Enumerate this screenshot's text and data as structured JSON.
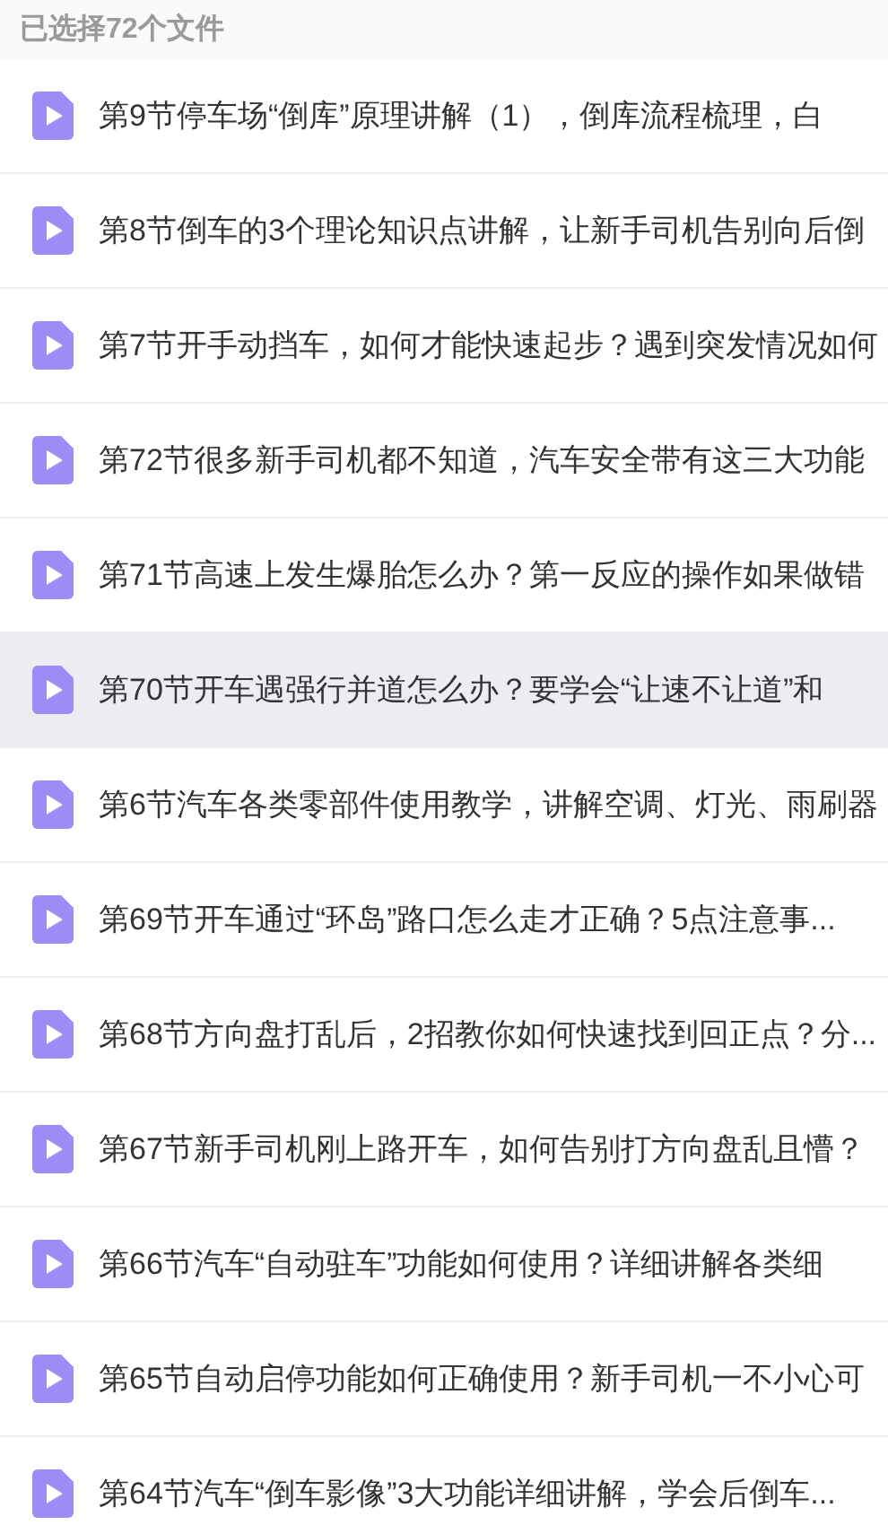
{
  "header": {
    "title": "已选择72个文件"
  },
  "files": [
    {
      "name": "第9节停车场“倒库”原理讲解（1），倒库流程梳理，白",
      "highlighted": false
    },
    {
      "name": "第8节倒车的3个理论知识点讲解，让新手司机告别向后倒",
      "highlighted": false
    },
    {
      "name": "第7节开手动挡车，如何才能快速起步？遇到突发情况如何",
      "highlighted": false
    },
    {
      "name": "第72节很多新手司机都不知道，汽车安全带有这三大功能",
      "highlighted": false
    },
    {
      "name": "第71节高速上发生爆胎怎么办？第一反应的操作如果做错",
      "highlighted": false
    },
    {
      "name": "第70节开车遇强行并道怎么办？要学会“让速不让道”和",
      "highlighted": true
    },
    {
      "name": "第6节汽车各类零部件使用教学，讲解空调、灯光、雨刷器",
      "highlighted": false
    },
    {
      "name": "第69节开车通过“环岛”路口怎么走才正确？5点注意事...",
      "highlighted": false
    },
    {
      "name": "第68节方向盘打乱后，2招教你如何快速找到回正点？分...",
      "highlighted": false
    },
    {
      "name": "第67节新手司机刚上路开车，如何告别打方向盘乱且懵？",
      "highlighted": false
    },
    {
      "name": "第66节汽车“自动驻车”功能如何使用？详细讲解各类细",
      "highlighted": false
    },
    {
      "name": "第65节自动启停功能如何正确使用？新手司机一不小心可",
      "highlighted": false
    },
    {
      "name": "第64节汽车“倒车影像”3大功能详细讲解，学会后倒车...",
      "highlighted": false
    }
  ]
}
